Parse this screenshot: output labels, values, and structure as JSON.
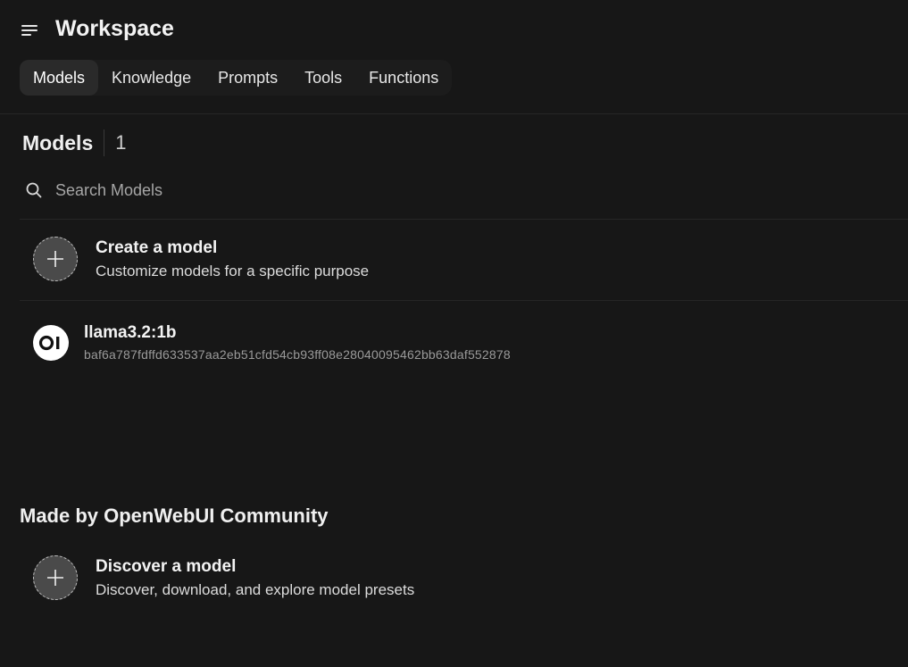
{
  "header": {
    "title": "Workspace",
    "menu_icon": "hamburger-menu-icon"
  },
  "tabs": [
    {
      "label": "Models",
      "active": true
    },
    {
      "label": "Knowledge",
      "active": false
    },
    {
      "label": "Prompts",
      "active": false
    },
    {
      "label": "Tools",
      "active": false
    },
    {
      "label": "Functions",
      "active": false
    }
  ],
  "models_section": {
    "title": "Models",
    "count": "1",
    "search_placeholder": "Search Models",
    "create_card": {
      "title": "Create a model",
      "subtitle": "Customize models for a specific purpose",
      "icon": "plus-icon"
    },
    "models": [
      {
        "name": "llama3.2:1b",
        "id": "baf6a787fdffd633537aa2eb51cfd54cb93ff08e28040095462bb63daf552878",
        "logo_text": "OI"
      }
    ]
  },
  "community_section": {
    "title": "Made by OpenWebUI Community",
    "discover_card": {
      "title": "Discover a model",
      "subtitle": "Discover, download, and explore model presets",
      "icon": "plus-icon"
    }
  },
  "colors": {
    "background": "#171717",
    "active_tab": "#2a2a2a",
    "text": "#ececec"
  }
}
